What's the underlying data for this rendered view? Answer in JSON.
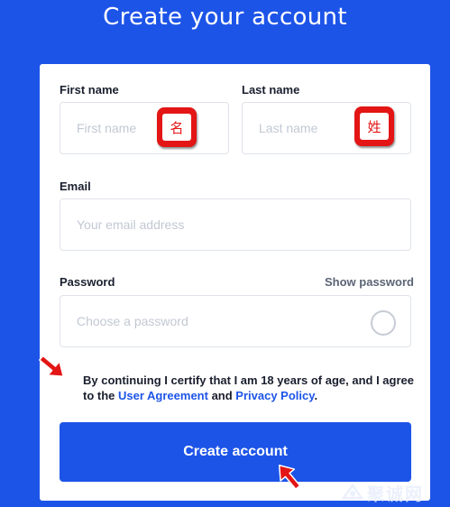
{
  "page": {
    "title": "Create your account"
  },
  "form": {
    "first_name": {
      "label": "First name",
      "placeholder": "First name",
      "annotation": "名"
    },
    "last_name": {
      "label": "Last name",
      "placeholder": "Last name",
      "annotation": "姓"
    },
    "email": {
      "label": "Email",
      "placeholder": "Your email address"
    },
    "password": {
      "label": "Password",
      "placeholder": "Choose a password",
      "show_label": "Show password"
    },
    "terms": {
      "prefix": "By continuing I certify that I am 18 years of age, and I agree to the ",
      "user_agreement": "User Agreement",
      "joiner": " and ",
      "privacy_policy": "Privacy Policy",
      "suffix": "."
    },
    "submit_label": "Create account"
  },
  "watermark": {
    "text": "聚诚网"
  },
  "colors": {
    "background": "#1d54e8",
    "accent": "#1d54e8",
    "annotation": "#e31515"
  }
}
